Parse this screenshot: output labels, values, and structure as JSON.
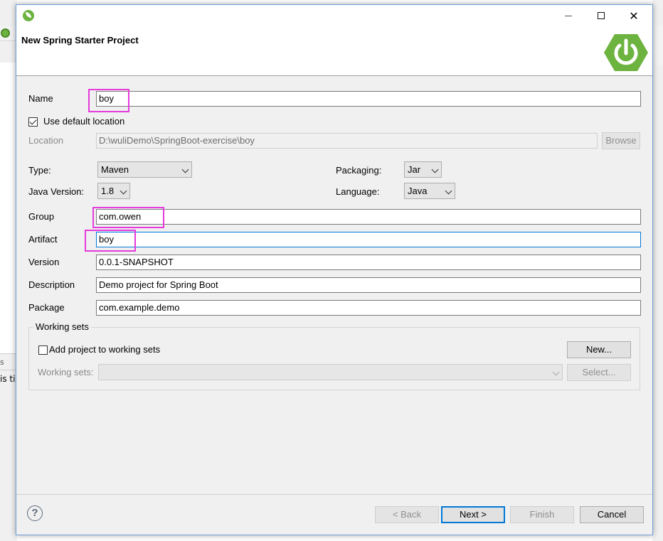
{
  "dialog": {
    "title": "New Spring Starter Project"
  },
  "form": {
    "name_label": "Name",
    "name_value": "boy",
    "use_default_location_label": "Use default location",
    "use_default_location_checked": true,
    "location_label": "Location",
    "location_value": "D:\\wuliDemo\\SpringBoot-exercise\\boy",
    "browse_label": "Browse",
    "type_label": "Type:",
    "type_value": "Maven",
    "packaging_label": "Packaging:",
    "packaging_value": "Jar",
    "java_version_label": "Java Version:",
    "java_version_value": "1.8",
    "language_label": "Language:",
    "language_value": "Java",
    "group_label": "Group",
    "group_value": "com.owen",
    "artifact_label": "Artifact",
    "artifact_value": "boy",
    "version_label": "Version",
    "version_value": "0.0.1-SNAPSHOT",
    "description_label": "Description",
    "description_value": "Demo project for Spring Boot",
    "package_label": "Package",
    "package_value": "com.example.demo"
  },
  "working_sets": {
    "title": "Working sets",
    "add_label": "Add project to working sets",
    "add_checked": false,
    "new_label": "New...",
    "sets_label": "Working sets:",
    "select_label": "Select..."
  },
  "footer": {
    "back_label": "< Back",
    "next_label": "Next >",
    "finish_label": "Finish",
    "cancel_label": "Cancel"
  },
  "background": {
    "tab_fragment": "s",
    "text_fragment": "is ti"
  },
  "colors": {
    "spring_green": "#6db33f",
    "highlight": "#e53bdc",
    "focus_blue": "#0078d7"
  }
}
